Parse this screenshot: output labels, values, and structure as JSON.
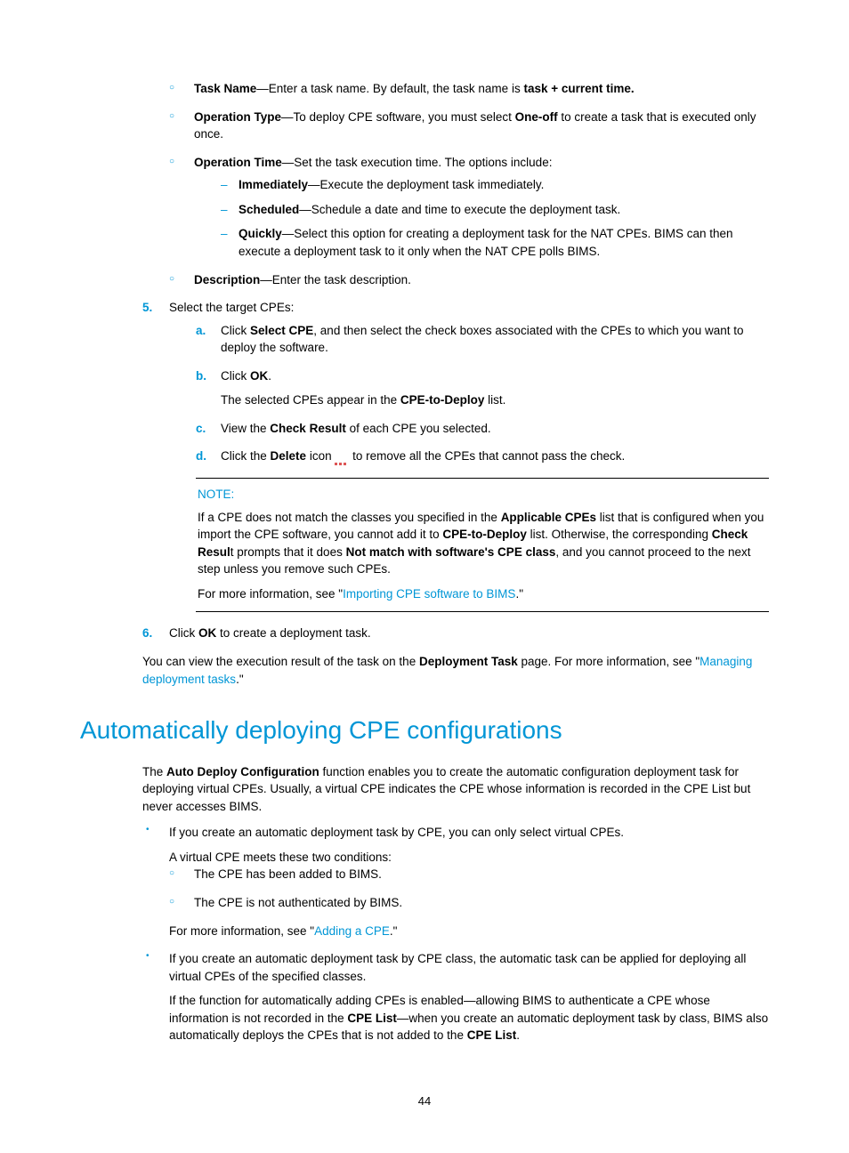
{
  "circA": {
    "taskName": {
      "label": "Task Name",
      "text": "—Enter a task name. By default, the task name is ",
      "tail": "task + current time."
    },
    "opType": {
      "label": "Operation Type",
      "text": "—To deploy CPE software, you must select ",
      "bold": "One-off",
      "tail": " to create a task that is executed only once."
    },
    "opTime": {
      "label": "Operation Time",
      "text": "—Set the task execution time. The options include:"
    },
    "desc": {
      "label": "Description",
      "text": "—Enter the task description."
    }
  },
  "dash": {
    "imm": {
      "label": "Immediately",
      "text": "—Execute the deployment task immediately."
    },
    "sched": {
      "label": "Scheduled",
      "text": "—Schedule a date and time to execute the deployment task."
    },
    "quick": {
      "label": "Quickly",
      "text": "—Select this option for creating a deployment task for the NAT CPEs. BIMS can then execute a deployment task to it only when the NAT CPE polls BIMS."
    }
  },
  "step5": {
    "marker": "5.",
    "text": "Select the target CPEs:",
    "a": {
      "m": "a.",
      "pre": "Click ",
      "bold": "Select CPE",
      "post": ", and then select the check boxes associated with the CPEs to which you want to deploy the software."
    },
    "b": {
      "m": "b.",
      "pre": "Click ",
      "bold": "OK",
      "post": ".",
      "sub1": "The selected CPEs appear in the ",
      "subBold": "CPE-to-Deploy",
      "sub2": " list."
    },
    "c": {
      "m": "c.",
      "pre": "View the ",
      "bold": "Check Result",
      "post": " of each CPE you selected."
    },
    "d": {
      "m": "d.",
      "pre": "Click the ",
      "bold": "Delete",
      "mid": " icon ",
      "post": " to remove all the CPEs that cannot pass the check."
    }
  },
  "note": {
    "label": "NOTE:",
    "p1a": "If a CPE does not match the classes you specified in the ",
    "p1b": "Applicable CPEs",
    "p1c": " list that is configured when you import the CPE software, you cannot add it to ",
    "p1d": "CPE-to-Deploy",
    "p1e": " list. Otherwise, the corresponding ",
    "p1f": "Check Resul",
    "p1g": "t prompts that it does ",
    "p1h": "Not match with software's CPE class",
    "p1i": ", and you cannot proceed to the next step unless you remove such CPEs.",
    "p2a": "For more information, see \"",
    "p2link": "Importing CPE software to BIMS",
    "p2b": ".\""
  },
  "step6": {
    "marker": "6.",
    "pre": "Click ",
    "bold": "OK",
    "post": " to create a deployment task."
  },
  "paraAfter": {
    "a": "You can view the execution result of the task on the ",
    "b": "Deployment Task",
    "c": " page. For more information, see \"",
    "link": "Managing deployment tasks",
    "d": ".\""
  },
  "h1": "Automatically deploying CPE configurations",
  "intro": {
    "a": "The ",
    "b": "Auto Deploy Configuration",
    "c": " function enables you to create the automatic configuration deployment task for deploying virtual CPEs. Usually, a virtual CPE indicates the CPE whose information is recorded in the CPE List but never accesses BIMS."
  },
  "bullet1": {
    "main": "If you create an automatic deployment task by CPE, you can only select virtual CPEs.",
    "sub": "A virtual CPE meets these two conditions:",
    "c1": "The CPE has been added to BIMS.",
    "c2": "The CPE is not authenticated by BIMS.",
    "moreA": "For more information, see \"",
    "moreLink": "Adding a CPE",
    "moreB": ".\""
  },
  "bullet2": {
    "main": "If you create an automatic deployment task by CPE class, the automatic task can be applied for deploying all virtual CPEs of the specified classes.",
    "p2a": "If the function for automatically adding CPEs is enabled—allowing BIMS to authenticate a CPE whose information is not recorded in the ",
    "p2b": "CPE List",
    "p2c": "—when you create an automatic deployment task by class, BIMS also automatically deploys the CPEs that is not added to the ",
    "p2d": "CPE List",
    "p2e": "."
  },
  "pageNumber": "44"
}
